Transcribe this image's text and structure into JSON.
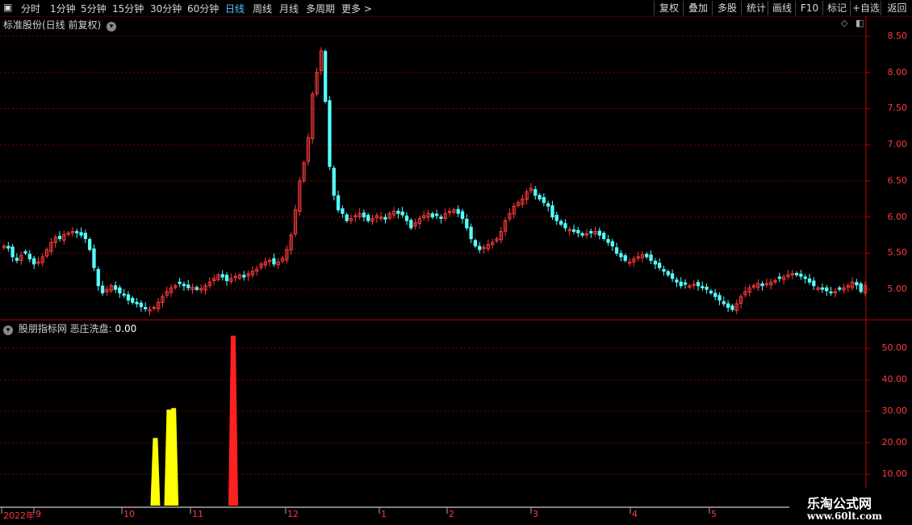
{
  "toolbar": {
    "left_items": [
      "分时",
      "1分钟",
      "5分钟",
      "15分钟",
      "30分钟",
      "60分钟",
      "日线",
      "周线",
      "月线",
      "多周期",
      "更多 >"
    ],
    "active_item": "日线",
    "right_items": [
      "复权",
      "叠加",
      "多股",
      "统计",
      "画线",
      "F10",
      "标记",
      "+自选",
      "返回"
    ]
  },
  "main_panel": {
    "title": "标准股份(日线 前复权)",
    "y_ticks": [
      "8.50",
      "8.00",
      "7.50",
      "7.00",
      "6.50",
      "6.00",
      "5.50",
      "5.00"
    ]
  },
  "indicator_panel": {
    "name": "股朋指标网",
    "series_label": "恶庄洗盘:",
    "series_value": "0.00",
    "y_ticks": [
      "50.00",
      "40.00",
      "30.00",
      "20.00",
      "10.00"
    ]
  },
  "x_axis": {
    "labels": [
      "2022年",
      "9",
      "10",
      "11",
      "12",
      "1",
      "2",
      "3",
      "4",
      "5"
    ]
  },
  "watermark": {
    "line1": "乐淘公式网",
    "line2": "www.60lt.com"
  },
  "colors": {
    "up": "#ff3b3b",
    "down": "#54ffff",
    "bg": "#000000",
    "axis": "#c00000",
    "yellow": "#ffff00"
  },
  "chart_data": [
    {
      "type": "candlestick",
      "y_axis": [
        4.6,
        8.6
      ],
      "close_values": [
        5.6,
        5.57,
        5.45,
        5.4,
        5.47,
        5.5,
        5.42,
        5.35,
        5.38,
        5.45,
        5.55,
        5.65,
        5.72,
        5.7,
        5.76,
        5.78,
        5.8,
        5.78,
        5.75,
        5.7,
        5.55,
        5.3,
        5.05,
        4.95,
        5.0,
        5.05,
        5.0,
        4.95,
        4.92,
        4.85,
        4.82,
        4.8,
        4.76,
        4.73,
        4.72,
        4.75,
        4.82,
        4.9,
        4.97,
        5.02,
        5.05,
        5.08,
        5.05,
        5.02,
        5.03,
        5.0,
        5.01,
        5.05,
        5.1,
        5.15,
        5.2,
        5.17,
        5.12,
        5.15,
        5.18,
        5.2,
        5.17,
        5.22,
        5.25,
        5.28,
        5.35,
        5.38,
        5.4,
        5.35,
        5.38,
        5.43,
        5.55,
        5.75,
        6.1,
        6.5,
        6.75,
        7.1,
        7.7,
        8.0,
        8.3,
        7.6,
        6.7,
        6.3,
        6.1,
        6.05,
        5.95,
        5.98,
        6.02,
        6.05,
        6.0,
        5.95,
        5.98,
        6.02,
        6.0,
        5.97,
        6.05,
        6.08,
        6.05,
        6.03,
        5.95,
        5.85,
        5.92,
        5.98,
        6.02,
        6.05,
        6.0,
        6.02,
        5.98,
        6.05,
        6.08,
        6.1,
        6.05,
        5.98,
        5.85,
        5.7,
        5.6,
        5.55,
        5.58,
        5.62,
        5.65,
        5.7,
        5.8,
        5.95,
        6.05,
        6.15,
        6.2,
        6.25,
        6.35,
        6.4,
        6.3,
        6.25,
        6.2,
        6.15,
        6.0,
        5.95,
        5.9,
        5.85,
        5.83,
        5.8,
        5.78,
        5.75,
        5.77,
        5.78,
        5.8,
        5.75,
        5.7,
        5.65,
        5.6,
        5.5,
        5.45,
        5.4,
        5.38,
        5.42,
        5.45,
        5.48,
        5.45,
        5.4,
        5.35,
        5.3,
        5.25,
        5.2,
        5.15,
        5.1,
        5.05,
        5.07,
        5.05,
        5.07,
        5.05,
        5.02,
        5.0,
        4.95,
        4.9,
        4.85,
        4.8,
        4.75,
        4.72,
        4.8,
        4.9,
        4.97,
        5.02,
        5.05,
        5.08,
        5.05,
        5.08,
        5.1,
        5.12,
        5.15,
        5.17,
        5.2,
        5.22,
        5.2,
        5.18,
        5.15,
        5.1,
        5.05,
        5.02,
        5.0,
        4.98,
        4.95,
        4.97,
        5.0,
        5.02,
        5.05,
        5.1,
        5.06,
        4.97,
        5.05
      ],
      "x_month_labels": [
        "2022年",
        "9",
        "10",
        "11",
        "12",
        "1",
        "2",
        "3",
        "4",
        "5"
      ]
    },
    {
      "type": "bar",
      "name": "恶庄洗盘",
      "y_axis": [
        0,
        58
      ],
      "bars": [
        {
          "index": 33,
          "value": 21.5,
          "color": "yellow"
        },
        {
          "index": 36,
          "value": 30.5,
          "color": "yellow"
        },
        {
          "index": 37,
          "value": 31.0,
          "color": "yellow"
        },
        {
          "index": 50,
          "value": 54.0,
          "color": "red"
        }
      ]
    }
  ]
}
